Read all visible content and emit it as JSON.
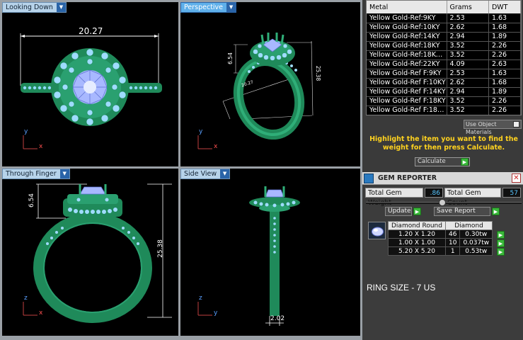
{
  "viewports": {
    "top_left": {
      "title": "Looking Down",
      "dimension": "20.27",
      "axis_y": "y",
      "axis_x": "x"
    },
    "top_right": {
      "title": "Perspective",
      "dim_a": "6.54",
      "dim_b": "25.38",
      "dim_c": "20.27",
      "axis_y": "y",
      "axis_x": "x"
    },
    "bottom_left": {
      "title": "Through Finger",
      "dim_a": "6.54",
      "dim_b": "25.38",
      "axis_z": "z",
      "axis_x": "x"
    },
    "bottom_right": {
      "title": "Side View",
      "dimension": "2.02",
      "axis_z": "z",
      "axis_y": "y"
    }
  },
  "metal_table": {
    "headers": [
      "Metal",
      "Grams",
      "DWT"
    ],
    "rows": [
      [
        "Yellow Gold-Ref:9KY",
        "2.53",
        "1.63"
      ],
      [
        "Yellow Gold-Ref:10KY",
        "2.62",
        "1.68"
      ],
      [
        "Yellow Gold-Ref:14KY",
        "2.94",
        "1.89"
      ],
      [
        "Yellow Gold-Ref:18KY",
        "3.52",
        "2.26"
      ],
      [
        "Yellow Gold-Ref:18KY ...",
        "3.52",
        "2.26"
      ],
      [
        "Yellow Gold-Ref:22KY",
        "4.09",
        "2.63"
      ],
      [
        "Yellow Gold-Ref F:9KY",
        "2.53",
        "1.63"
      ],
      [
        "Yellow Gold-Ref F:10KY",
        "2.62",
        "1.68"
      ],
      [
        "Yellow Gold-Ref F:14KY",
        "2.94",
        "1.89"
      ],
      [
        "Yellow Gold-Ref F:18KY",
        "3.52",
        "2.26"
      ],
      [
        "Yellow Gold-Ref F:18K...",
        "3.52",
        "2.26"
      ]
    ]
  },
  "use_object_materials": "Use Object Materials",
  "hint": "Highlight the item you want to find the weight for then press Calculate.",
  "calculate_label": "Calculate",
  "gem_reporter": {
    "title": "GEM REPORTER",
    "total_weight_label": "Total Gem Weight",
    "total_weight_value": ".86",
    "total_count_label": "Total Gem Count",
    "total_count_value": "57",
    "update_label": "Update",
    "save_label": "Save Report",
    "table_headers": [
      "Diamond Round",
      "Diamond"
    ],
    "rows": [
      [
        "1.20 X 1.20",
        "46",
        "0.30tw"
      ],
      [
        "1.00 X 1.00",
        "10",
        "0.037tw"
      ],
      [
        "5.20 X 5.20",
        "1",
        "0.53tw"
      ]
    ]
  },
  "ring_size": "RING SIZE - 7 US",
  "colors": {
    "ring_green": "#1f8a5a",
    "ring_cyan": "#8fd8ff",
    "viewport_bg": "#000000",
    "hint_yellow": "#ffd21f",
    "tab_active": "#5fb0ea"
  }
}
